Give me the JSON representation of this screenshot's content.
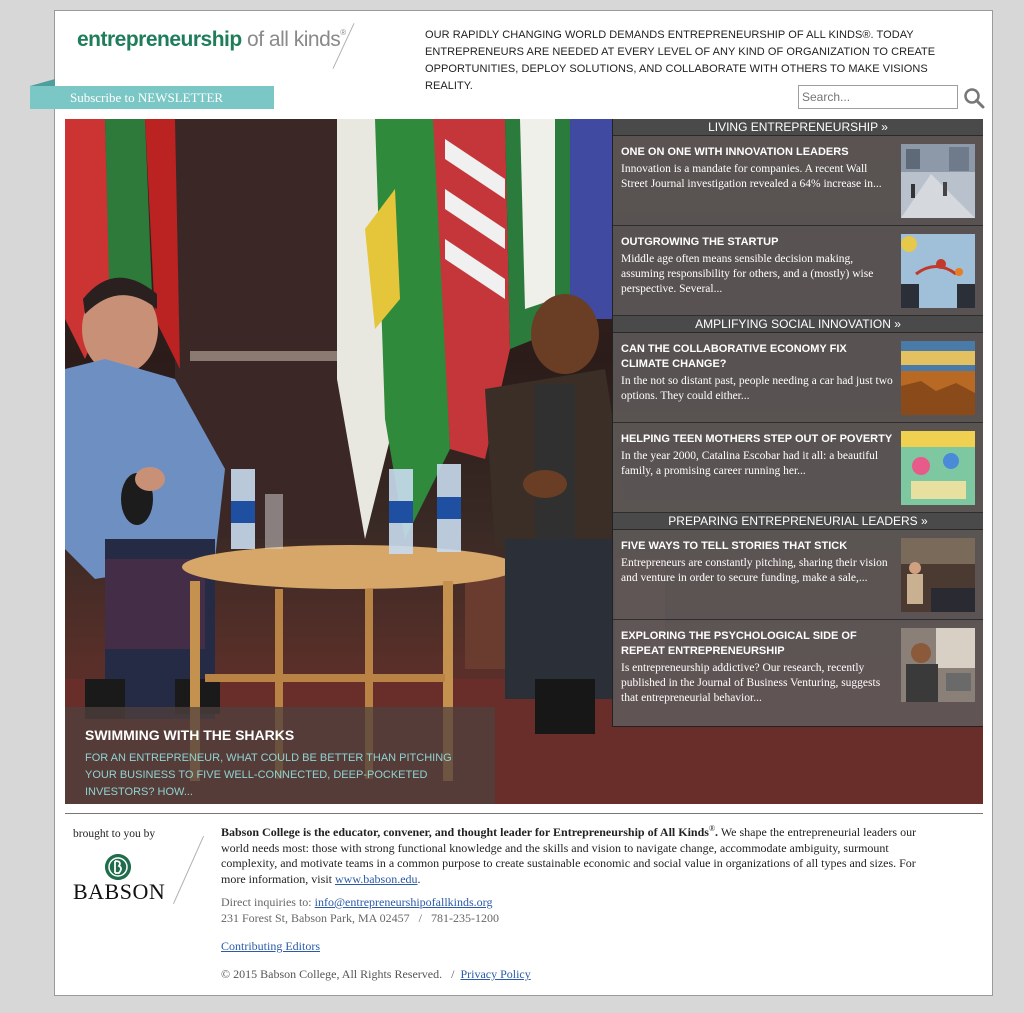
{
  "header": {
    "logo_primary": "entrepreneurship",
    "logo_secondary": " of all kinds",
    "logo_reg": "®",
    "tagline": "OUR RAPIDLY CHANGING WORLD DEMANDS ENTREPRENEURSHIP OF ALL KINDS®. TODAY ENTREPRENEURS ARE NEEDED AT EVERY LEVEL OF ANY KIND OF ORGANIZATION TO CREATE OPPORTUNITIES, DEPLOY SOLUTIONS, AND COLLABORATE WITH OTHERS TO MAKE VISIONS REALITY.",
    "newsletter": "Subscribe to NEWSLETTER",
    "search_placeholder": "Search..."
  },
  "hero": {
    "title": "SWIMMING WITH THE SHARKS",
    "description": "FOR AN ENTREPRENEUR, WHAT COULD BE BETTER THAN PITCHING YOUR BUSINESS TO FIVE WELL-CONNECTED, DEEP-POCKETED INVESTORS? HOW..."
  },
  "sections": [
    {
      "heading": "LIVING ENTREPRENEURSHIP »",
      "stories": [
        {
          "title": "ONE ON ONE WITH INNOVATION LEADERS",
          "text": "Innovation is a mandate for companies. A recent Wall Street Journal investigation revealed a 64% increase in..."
        },
        {
          "title": "OUTGROWING THE STARTUP",
          "text": "Middle age often means sensible decision making, assuming responsibility for others, and a (mostly) wise perspective. Several..."
        }
      ]
    },
    {
      "heading": "AMPLIFYING SOCIAL INNOVATION »",
      "stories": [
        {
          "title": "CAN THE COLLABORATIVE ECONOMY FIX CLIMATE CHANGE?",
          "text": "In the not so distant past, people needing a car had just two options. They could either..."
        },
        {
          "title": "HELPING TEEN MOTHERS STEP OUT OF POVERTY",
          "text": "In the year 2000, Catalina Escobar had it all: a beautiful family, a promising career running her..."
        }
      ]
    },
    {
      "heading": "PREPARING ENTREPRENEURIAL LEADERS »",
      "stories": [
        {
          "title": "FIVE WAYS TO TELL STORIES THAT STICK",
          "text": "Entrepreneurs are constantly pitching, sharing their vision and venture in order to secure funding, make a sale,..."
        },
        {
          "title": "EXPLORING THE PSYCHOLOGICAL SIDE OF REPEAT ENTREPRENEURSHIP",
          "text": "Is entrepreneurship addictive? Our research, recently published in the Journal of Business Venturing, suggests that entrepreneurial behavior..."
        }
      ]
    }
  ],
  "footer": {
    "brought": "brought to you by",
    "babson": "BABSON",
    "lead_bold": "Babson College is the educator, convener, and thought leader for Entrepreneurship of All Kinds",
    "lead_sup": "®",
    "lead_end": ".",
    "body": " We shape the entrepreneurial leaders our world needs most: those with strong functional knowledge and the skills and vision to navigate change, accommodate ambiguity, surmount complexity, and motivate teams in a common purpose to create sustainable economic and social value in organizations of all types and sizes. For more information, visit ",
    "site_link": "www.babson.edu",
    "body_end": ".",
    "inquiries_label": "Direct inquiries to: ",
    "email": "info@entrepreneurshipofallkinds.org",
    "address": "231 Forest St, Babson Park, MA 02457   /   781-235-1200",
    "editors": "Contributing Editors",
    "copyright": "© 2015 Babson College, All Rights Reserved.   /  ",
    "privacy": "Privacy Policy"
  }
}
